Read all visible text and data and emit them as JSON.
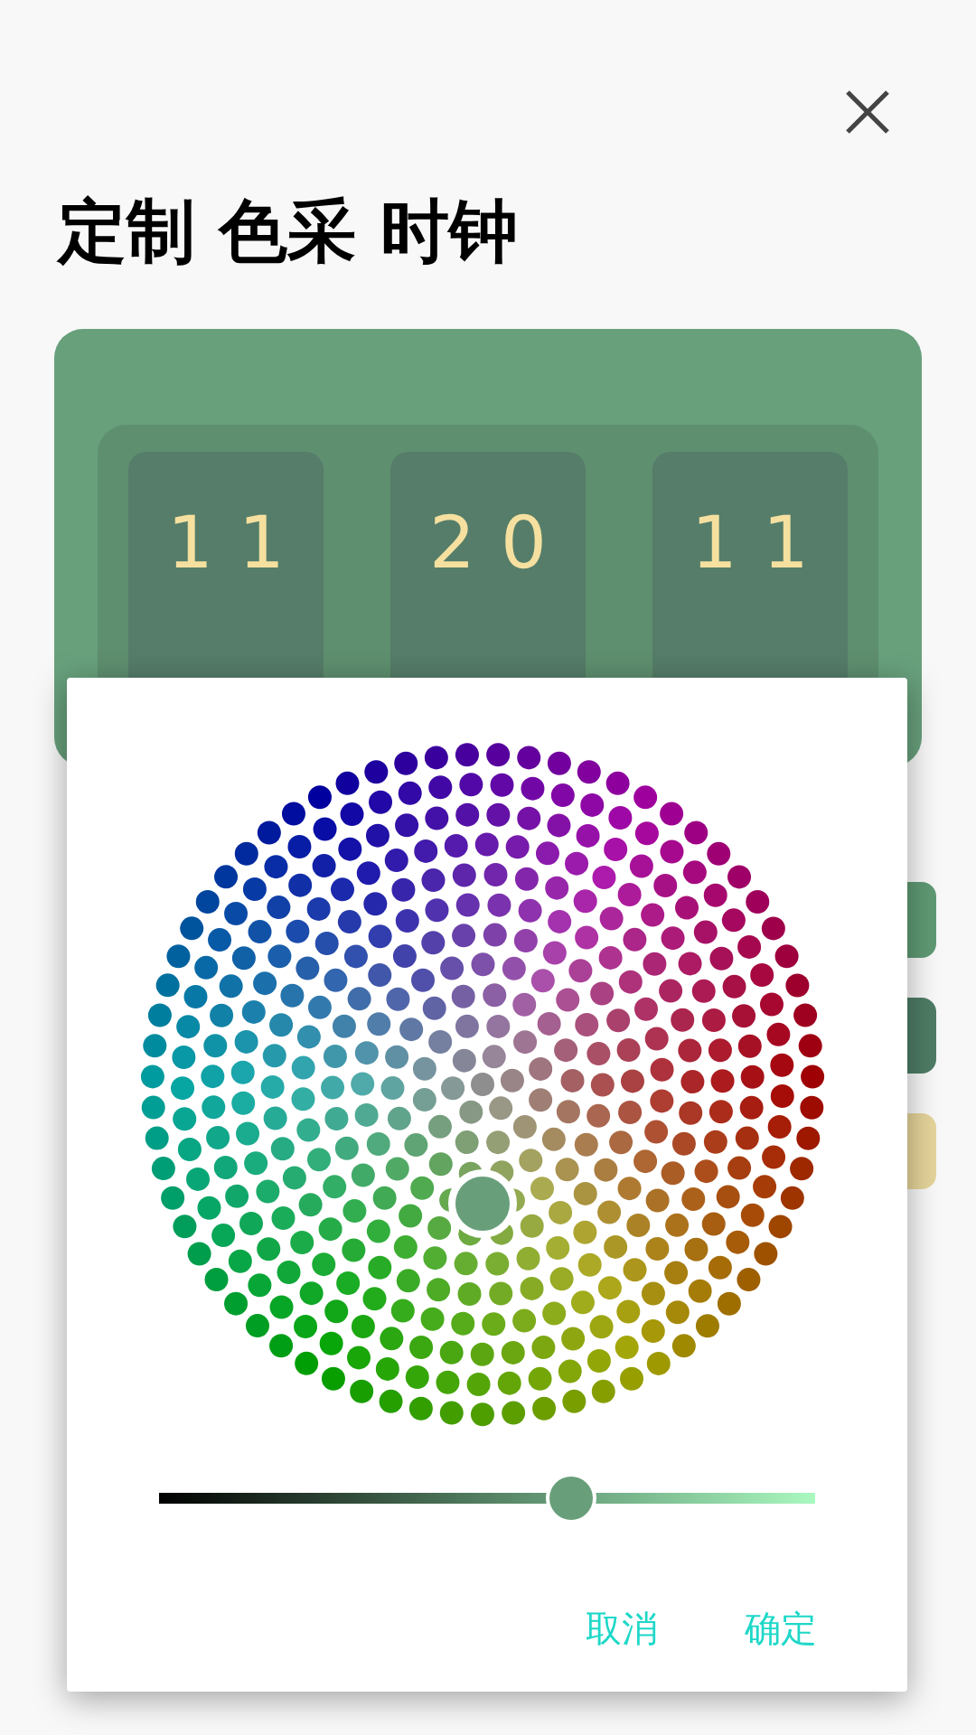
{
  "title": "定制 色采 时钟",
  "clock": {
    "digits": [
      "11",
      "20",
      "11"
    ]
  },
  "swatches": [
    {
      "color": "#5f9a74"
    },
    {
      "color": "#4e7c65"
    },
    {
      "color": "#e5d49a"
    }
  ],
  "dialog": {
    "selector": {
      "color": "#689f7a"
    },
    "brightness": {
      "level": 0.62
    },
    "buttons": [
      "取消",
      "确定"
    ]
  }
}
